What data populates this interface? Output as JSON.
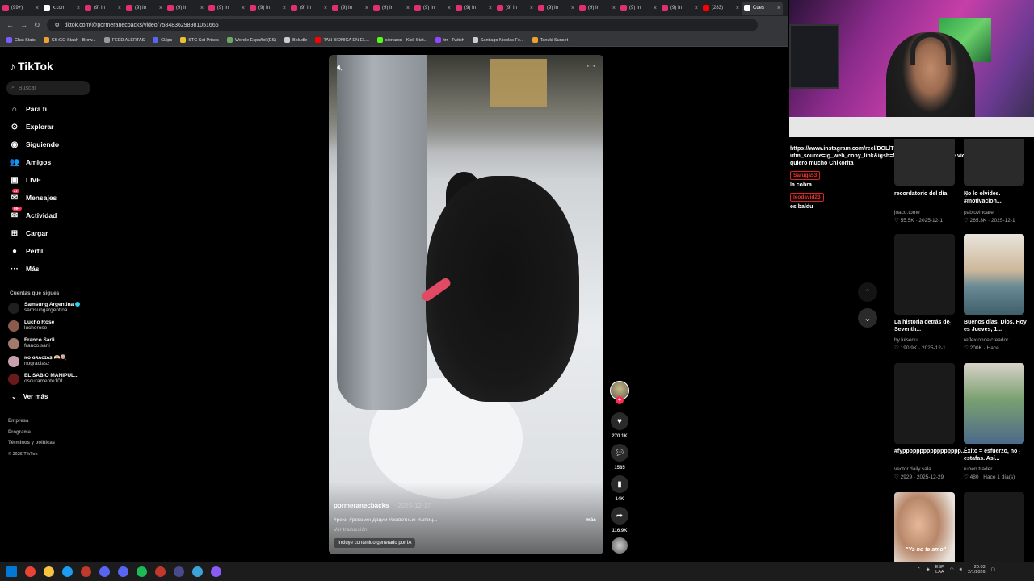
{
  "browser": {
    "tabs": [
      {
        "label": "(99+)",
        "color": "#e1306c"
      },
      {
        "label": "x.com",
        "color": "#ffffff"
      },
      {
        "label": "(9) In",
        "color": "#e1306c"
      },
      {
        "label": "(9) In",
        "color": "#e1306c"
      },
      {
        "label": "(9) In",
        "color": "#e1306c"
      },
      {
        "label": "(9) In",
        "color": "#e1306c"
      },
      {
        "label": "(9) In",
        "color": "#e1306c"
      },
      {
        "label": "(9) In",
        "color": "#e1306c"
      },
      {
        "label": "(9) In",
        "color": "#e1306c"
      },
      {
        "label": "(9) In",
        "color": "#e1306c"
      },
      {
        "label": "(9) In",
        "color": "#e1306c"
      },
      {
        "label": "(9) In",
        "color": "#e1306c"
      },
      {
        "label": "(9) In",
        "color": "#e1306c"
      },
      {
        "label": "(9) In",
        "color": "#e1306c"
      },
      {
        "label": "(9) In",
        "color": "#e1306c"
      },
      {
        "label": "(9) In",
        "color": "#e1306c"
      },
      {
        "label": "(9) In",
        "color": "#e1306c"
      },
      {
        "label": "(283)",
        "color": "#ff0000"
      },
      {
        "label": "Cues",
        "color": "#ffffff"
      }
    ],
    "url": "tiktok.com/@pormeranecbacks/video/7584836298981051666",
    "bookmarks": [
      {
        "label": "Chat Stats",
        "color": "#7c5cff"
      },
      {
        "label": "CS:GO Stash - Brow...",
        "color": "#f0a030"
      },
      {
        "label": "FEED ALERTAS",
        "color": "#999999"
      },
      {
        "label": "CLips",
        "color": "#5865f2"
      },
      {
        "label": "STC Set Prices",
        "color": "#f0c030"
      },
      {
        "label": "Wordle Español (ES)",
        "color": "#6aaa64"
      },
      {
        "label": "Boludle",
        "color": "#cccccc"
      },
      {
        "label": "TAN BIONICA EN EL...",
        "color": "#ff0000"
      },
      {
        "label": "sionaron - Kick Stat...",
        "color": "#53fc18"
      },
      {
        "label": "trr - Twitch",
        "color": "#9146ff"
      },
      {
        "label": "Santiago Nicolas Fe...",
        "color": "#cccccc"
      },
      {
        "label": "Tanuki Sunset",
        "color": "#f0a030"
      }
    ]
  },
  "sidebar": {
    "logo": "TikTok",
    "search_placeholder": "Buscar",
    "nav": [
      {
        "label": "Para ti",
        "icon": "home-icon",
        "glyph": "⌂"
      },
      {
        "label": "Explorar",
        "icon": "compass-icon",
        "glyph": "⊙"
      },
      {
        "label": "Siguiendo",
        "icon": "following-icon",
        "glyph": "◉"
      },
      {
        "label": "Amigos",
        "icon": "friends-icon",
        "glyph": "👥"
      },
      {
        "label": "LIVE",
        "icon": "live-icon",
        "glyph": "▣"
      },
      {
        "label": "Mensajes",
        "icon": "messages-icon",
        "glyph": "✉",
        "badge": "27"
      },
      {
        "label": "Actividad",
        "icon": "activity-icon",
        "glyph": "✉",
        "badge": "99+"
      },
      {
        "label": "Cargar",
        "icon": "upload-icon",
        "glyph": "⊞"
      },
      {
        "label": "Perfil",
        "icon": "profile-icon",
        "glyph": "●"
      },
      {
        "label": "Más",
        "icon": "more-icon",
        "glyph": "···"
      }
    ],
    "following_title": "Cuentas que sigues",
    "accounts": [
      {
        "name": "Samsung Argentina",
        "handle": "samsungargentina",
        "verified": true,
        "color": "#1f1f1f"
      },
      {
        "name": "Lucho Rose",
        "handle": "luchorose",
        "verified": false,
        "color": "#8a5a4a"
      },
      {
        "name": "Franco Sarli",
        "handle": "franco.sarli",
        "verified": false,
        "color": "#a07a6a"
      },
      {
        "name": "ɴᴏ ɢʀᴀᴄɪᴀꜱ 🫶🏻🍭",
        "handle": "nograciasz",
        "verified": false,
        "color": "#c9a0b0"
      },
      {
        "name": "EL SABIO MANIPUL...",
        "handle": "oscuramente101",
        "verified": false,
        "color": "#6a1a1a"
      }
    ],
    "see_more": "Ver más",
    "footer": [
      "Empresa",
      "Programa",
      "Términos y políticas",
      "© 2026 TikTok"
    ]
  },
  "video": {
    "author": "pormeranecbacks",
    "date": "2025-12-17",
    "tags": "#реки #рекомендации #животные #шпиц...",
    "more": "más",
    "translate": "Ver traducción",
    "ai_label": "Incluye contenido generado por IA",
    "likes": "270.1K",
    "comments": "1585",
    "saves": "14K",
    "shares": "116.9K"
  },
  "chat": {
    "messages": [
      {
        "name": "",
        "text": "https://www.instagram.com/reel/DOLlTCWDul9/?utm_source=ig_web_copy_link&igsh=MzRlODBiNWFlZA== re violado el tercero, te quiero mucho Chikorita"
      },
      {
        "name": "Saruga53",
        "text": "la cobra"
      },
      {
        "name": "leodavid23",
        "text": "es baldu"
      }
    ]
  },
  "grid": [
    {
      "title": "recordatorio del día",
      "author": "joaco.tome",
      "stats": "♡ 55.5K · 2025-12-1",
      "top": true
    },
    {
      "title": "No lo olvides. #motivacion...",
      "author": "pablovincare",
      "stats": "♡ 265.3K · 2025-12-1",
      "top": true
    },
    {
      "title": "La historia detrás de Seventh...",
      "author": "by.luisedu",
      "stats": "♡ 190.9K · 2025-12-1",
      "thumb": "#1a1a1a"
    },
    {
      "title": "Buenos días, Dios. Hoy es Jueves, 1...",
      "author": "reflexiondelcreador",
      "stats": "♡ 200K · Hace...",
      "thumb": "beach"
    },
    {
      "title": "#fyppppppppppppppppp...",
      "author": "vector.daily.sala",
      "stats": "♡ 2929 · 2025-12-29",
      "thumb": "#1a1a1a"
    },
    {
      "title": "Éxito = esfuerzo, no estafas. Así...",
      "author": "ruben.trader",
      "stats": "♡ 480 · Hace 1 día(s)",
      "thumb": "person"
    },
    {
      "title": "",
      "author": "",
      "stats": "",
      "thumb": "selfie",
      "caption": "\"Ya no te amo\""
    },
    {
      "title": "",
      "author": "",
      "stats": "",
      "thumb": "#1a1a1a"
    }
  ],
  "taskbar": {
    "lang1": "ESP",
    "lang2": "LAA",
    "time": "20:03",
    "date": "2/1/2026"
  }
}
